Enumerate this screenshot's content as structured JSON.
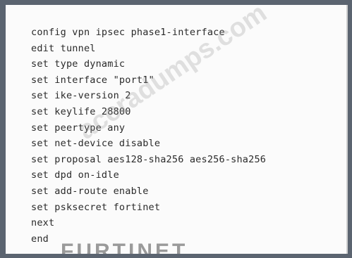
{
  "code": {
    "lines": [
      "config vpn ipsec phase1-interface",
      "edit tunnel",
      "set type dynamic",
      "set interface \"port1\"",
      "set ike-version 2",
      "set keylife 28800",
      "set peertype any",
      "set net-device disable",
      "set proposal aes128-sha256 aes256-sha256",
      "set dpd on-idle",
      "set add-route enable",
      "set psksecret fortinet",
      "next",
      "end"
    ]
  },
  "watermark": {
    "text": "aceradumps.com"
  },
  "logo": {
    "text": "FURTINET"
  }
}
